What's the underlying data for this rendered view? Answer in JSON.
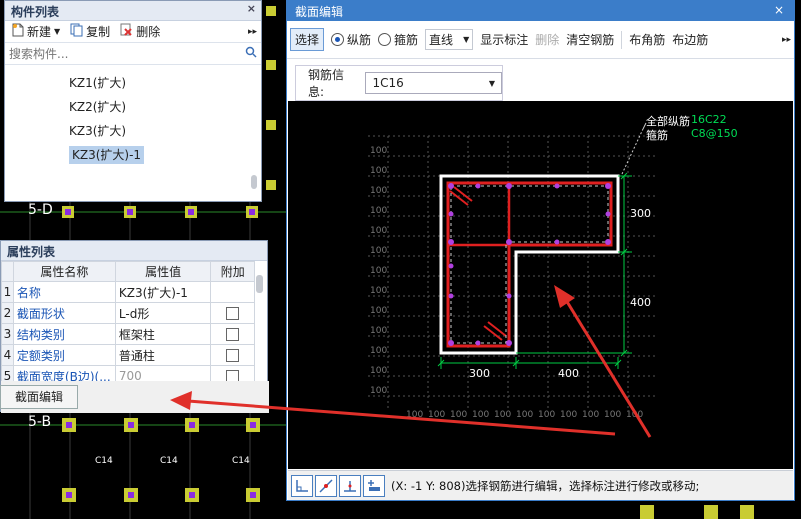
{
  "background": {
    "axis_labels": [
      "5-D",
      "5-B"
    ],
    "tag_labels": [
      "C14",
      "C14",
      "C14",
      "C14",
      "C14",
      "C14"
    ]
  },
  "component_list": {
    "title": "构件列表",
    "close_label": "×",
    "toolbar": {
      "new_label": "新建",
      "copy_label": "复制",
      "delete_label": "删除",
      "more_label": "▸▸"
    },
    "search_placeholder": "搜索构件...",
    "items": [
      "KZ1(扩大)",
      "KZ2(扩大)",
      "KZ3(扩大)",
      "KZ3(扩大)-1"
    ],
    "selected_index": 3
  },
  "property_list": {
    "title": "属性列表",
    "headers": [
      "属性名称",
      "属性值",
      "附加"
    ],
    "rows": [
      {
        "idx": "1",
        "name": "名称",
        "value": "KZ3(扩大)-1",
        "has_check": false
      },
      {
        "idx": "2",
        "name": "截面形状",
        "value": "L-d形",
        "has_check": true
      },
      {
        "idx": "3",
        "name": "结构类别",
        "value": "框架柱",
        "has_check": true
      },
      {
        "idx": "4",
        "name": "定额类别",
        "value": "普通柱",
        "has_check": true
      },
      {
        "idx": "5",
        "name": "截面宽度(B边)(...",
        "value": "700",
        "has_check": true
      }
    ],
    "edit_button_label": "截面编辑"
  },
  "dialog": {
    "title": "截面编辑",
    "close_label": "×",
    "toolbar": {
      "select_label": "选择",
      "radio_longitudinal": "纵筋",
      "radio_stirrup": "箍筋",
      "line_type": "直线",
      "show_annotation": "显示标注",
      "delete": "删除",
      "clear_rebar": "清空钢筋",
      "corner_rebar": "布角筋",
      "edge_rebar": "布边筋",
      "more": "▸▸"
    },
    "rebar_info_label": "钢筋信息:",
    "rebar_info_value": "1C16",
    "canvas": {
      "legend_all_long_label": "全部纵筋",
      "legend_all_long_value": "16C22",
      "legend_stirrup_label": "箍筋",
      "legend_stirrup_value": "C8@150",
      "dim_right_top": "300",
      "dim_right_bottom": "400",
      "dim_bottom_left": "300",
      "dim_bottom_right": "400",
      "grid_label": "100"
    },
    "status_text": "(X: -1 Y: 808)选择钢筋进行编辑，选择标注进行修改或移动;"
  },
  "colors": {
    "dialog_title_bg": "#3b7dc9",
    "rebar_red": "#e02020",
    "annotation_green": "#00cc44",
    "arrow_red": "#e0302a"
  }
}
